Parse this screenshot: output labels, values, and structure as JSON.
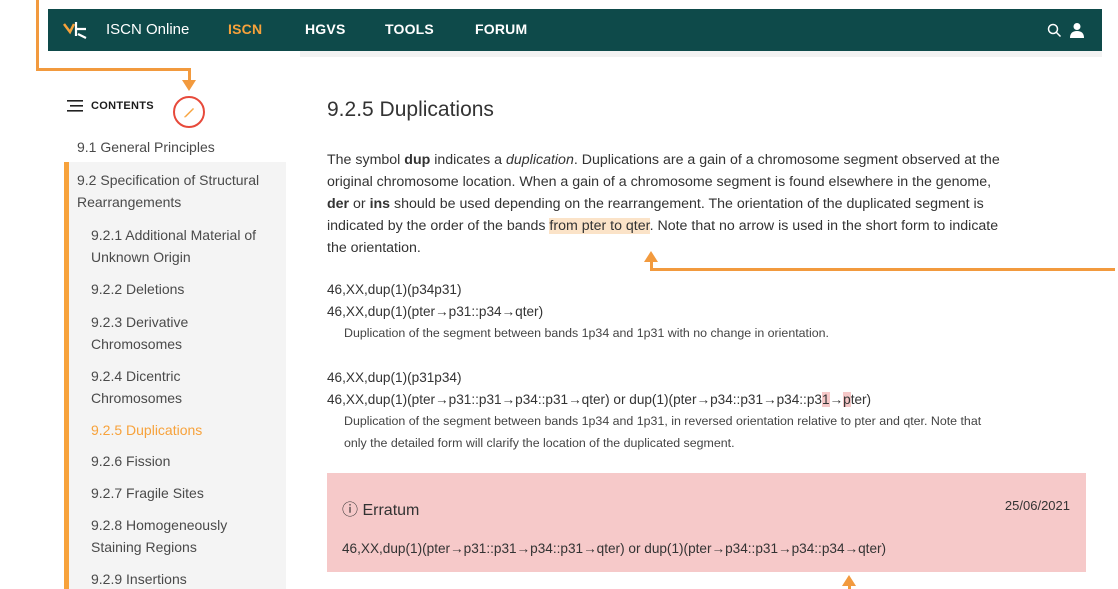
{
  "navbar": {
    "brand": "ISCN Online",
    "items": [
      "ISCN",
      "HGVS",
      "TOOLS",
      "FORUM"
    ],
    "active": "ISCN",
    "icons": [
      "search-icon",
      "user-icon"
    ]
  },
  "sidebar": {
    "header": "CONTENTS",
    "items": [
      "9.1 General Principles",
      "9.2 Specification of Structural",
      "Rearrangements",
      "9.2.1 Additional Material of",
      "Unknown Origin",
      "9.2.2 Deletions",
      "9.2.3 Derivative",
      "Chromosomes",
      "9.2.4 Dicentric",
      "Chromosomes",
      "9.2.5 Duplications",
      "9.2.6 Fission",
      "9.2.7 Fragile Sites",
      "9.2.8 Homogeneously",
      "Staining Regions",
      "9.2.9 Insertions"
    ]
  },
  "main": {
    "title": "9.2.5 Duplications",
    "intro": {
      "l1a": "The symbol ",
      "l1b": "dup",
      "l1c": " indicates a ",
      "l1d": "duplication",
      "l1e": ". Duplications are a gain of a chromosome segment observed at the",
      "l2": "original chromosome location. When a gain of a chromosome segment is found elsewhere in the genome,",
      "l3a": "der",
      "l3b": " or ",
      "l3c": "ins",
      "l3d": " should be used depending on the rearrangement. The orientation of the duplicated segment is",
      "l4a": "indicated by the order of the bands ",
      "l4b": "from pter to qter",
      "l4c": ". Note that no arrow is used in the short form to indicate",
      "l5": "the orientation."
    },
    "ex1_short": "46,XX,dup(1)(p34p31)",
    "ex1_long": "46,XX,dup(1)(pter→p31::p34→qter)",
    "ex1_desc": "Duplication of the segment between bands 1p34 and 1p31 with no change in orientation.",
    "ex2_short": "46,XX,dup(1)(p31p34)",
    "ex2_long_a": "46,XX,dup(1)(pter→p31::p31→p34::p31→qter) or dup(1)(pter→p34::p31→p34::p3",
    "ex2_long_b": "1",
    "ex2_long_c": "→",
    "ex2_long_d": "p",
    "ex2_long_e": "ter)",
    "ex2_desc_1": "Duplication of the segment between bands 1p34 and 1p31, in reversed orientation relative to pter and qter. Note that",
    "ex2_desc_2": "only the detailed form will clarify the location of the duplicated segment.",
    "erratum": {
      "icon": "ⓘ",
      "title": "Erratum",
      "date": "25/06/2021",
      "body": "46,XX,dup(1)(pter→p31::p31→p34::p31→qter) or dup(1)(pter→p34::p31→p34::p34→qter)"
    }
  },
  "colors": {
    "navbar": "#0e4a4a",
    "accent": "#f7a23b",
    "erratum_bg": "#f6c9c9",
    "callout": "#f29a3e"
  }
}
